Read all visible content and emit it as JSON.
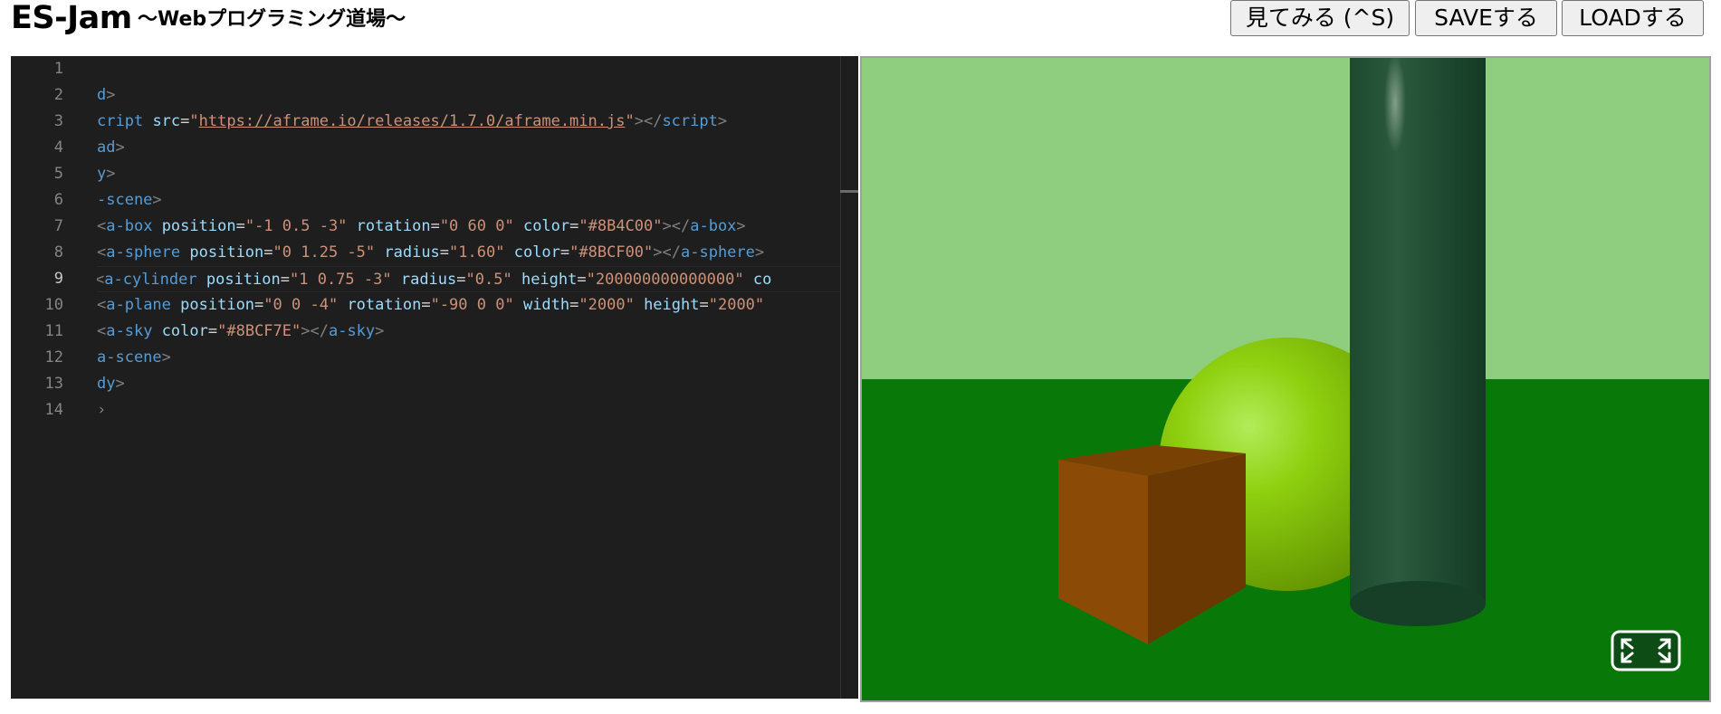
{
  "header": {
    "title": "ES-Jam",
    "subtitle": "〜Webプログラミング道場〜"
  },
  "toolbar": {
    "preview_label": "見てみる (^S)",
    "save_label": "SAVEする",
    "load_label": "LOADする"
  },
  "editor": {
    "line_numbers": [
      "1",
      "2",
      "3",
      "4",
      "5",
      "6",
      "7",
      "8",
      "9",
      "10",
      "11",
      "12",
      "13",
      "14"
    ],
    "active_line": 9
  },
  "scene": {
    "sky_color": "#8BCF7E",
    "ground_color": "#087908",
    "box_color": "#8B4C00",
    "sphere_color": "#8BCF00",
    "cylinder_color": "#1B4B2F",
    "fullscreen_icon": "fullscreen-expand-icon"
  }
}
